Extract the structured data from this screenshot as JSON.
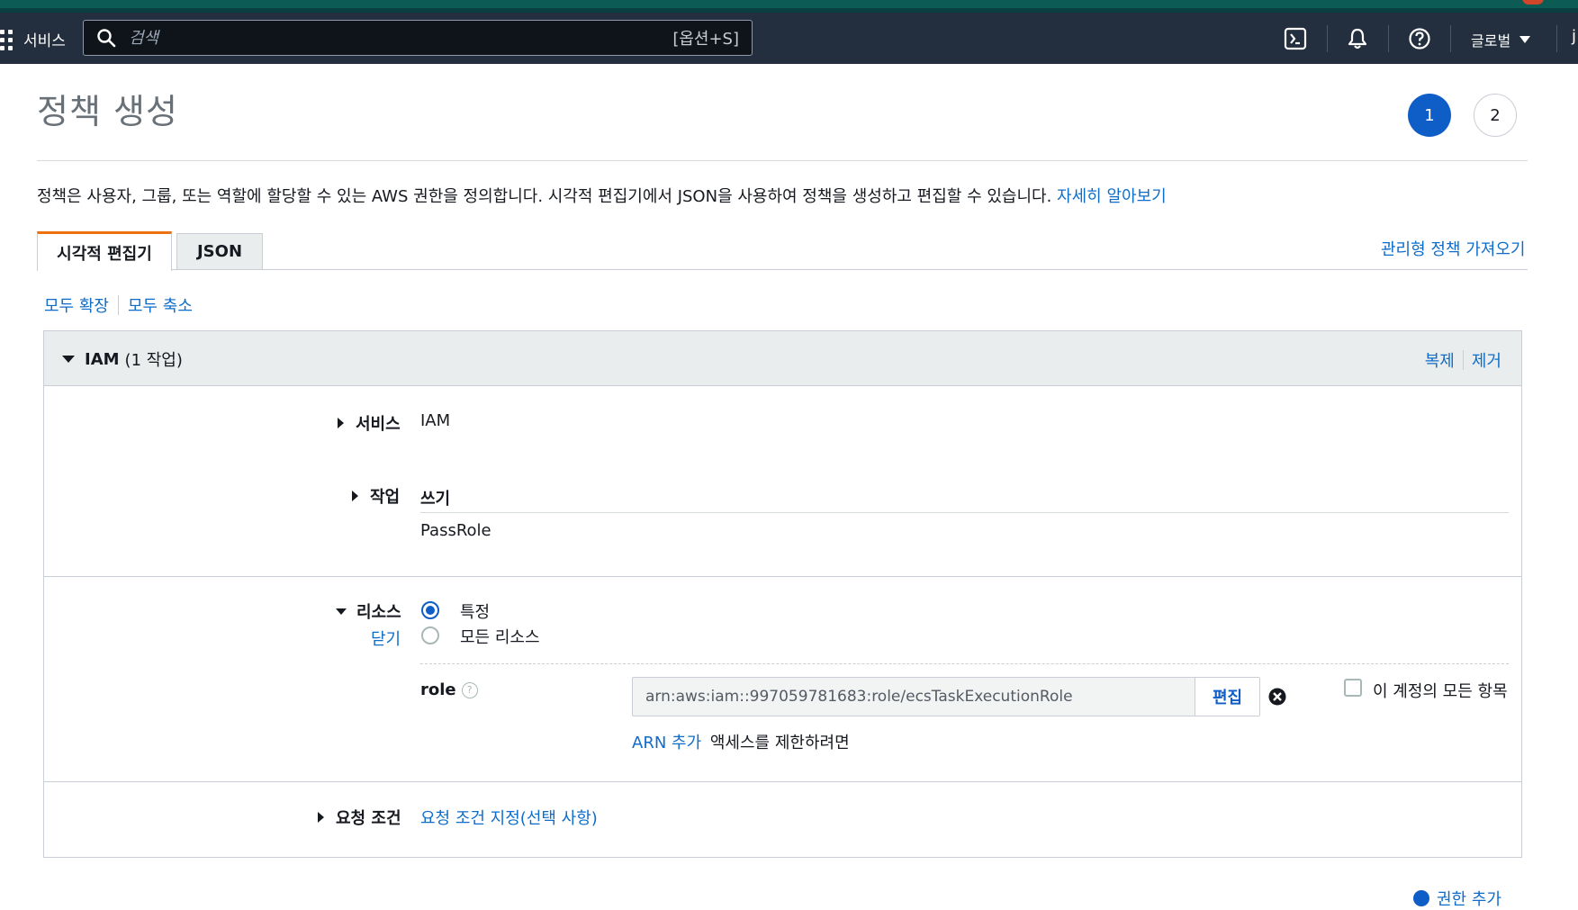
{
  "nav": {
    "services_label": "서비스",
    "search_placeholder": "검색",
    "search_shortcut": "[옵션+S]",
    "region_label": "글로벌",
    "user_initial": "j"
  },
  "page": {
    "title": "정책 생성",
    "steps": [
      "1",
      "2"
    ],
    "description": "정책은 사용자, 그룹, 또는 역할에 할당할 수 있는 AWS 권한을 정의합니다. 시각적 편집기에서 JSON을 사용하여 정책을 생성하고 편집할 수 있습니다.",
    "learn_more": "자세히 알아보기"
  },
  "tabs": {
    "visual": "시각적 편집기",
    "json": "JSON",
    "import_managed": "관리형 정책 가져오기"
  },
  "expand": {
    "expand_all": "모두 확장",
    "collapse_all": "모두 축소"
  },
  "panel": {
    "service_name": "IAM",
    "action_count": "(1 작업)",
    "duplicate": "복제",
    "remove": "제거",
    "service": {
      "label": "서비스",
      "value": "IAM"
    },
    "actions": {
      "label": "작업",
      "access_level": "쓰기",
      "value": "PassRole"
    },
    "resources": {
      "label": "리소스",
      "close": "닫기",
      "option_specific": "특정",
      "option_all": "모든 리소스",
      "role_label": "role",
      "help": "?",
      "arn_value": "arn:aws:iam::997059781683:role/ecsTaskExecutionRole",
      "edit": "편집",
      "any_in_account": "이 계정의 모든 항목",
      "add_arn": "ARN 추가",
      "add_arn_suffix": "액세스를 제한하려면"
    },
    "conditions": {
      "label": "요청 조건",
      "link": "요청 조건 지정(선택 사항)"
    }
  },
  "footer": {
    "add_more": "권한 추가"
  },
  "colors": {
    "nav_bg": "#232f3e",
    "accent_blue": "#0f5ec7",
    "link_blue": "#0f6dc9",
    "tab_active_border": "#ec7211"
  }
}
